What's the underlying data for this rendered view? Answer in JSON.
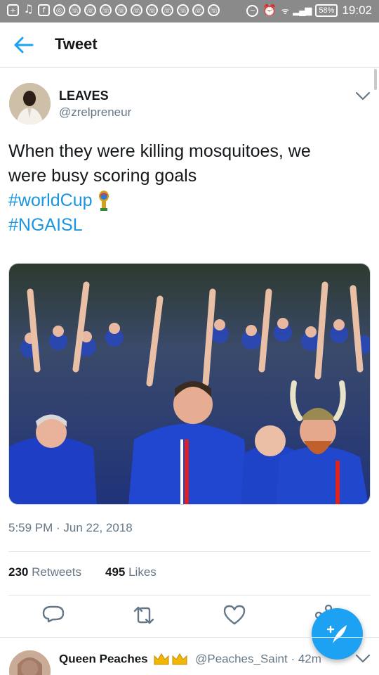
{
  "status_bar": {
    "battery": "58%",
    "time": "19:02",
    "left_icons": [
      "plus-box-icon",
      "music-note-icon",
      "facebook-icon",
      "chrome-icon",
      "whatsapp-icon",
      "whatsapp-icon",
      "whatsapp-icon",
      "whatsapp-icon",
      "whatsapp-icon",
      "whatsapp-icon",
      "whatsapp-icon",
      "whatsapp-icon",
      "whatsapp-icon",
      "whatsapp-icon"
    ],
    "right_icons": [
      "do-not-disturb-icon",
      "alarm-icon",
      "wifi-icon",
      "signal-icon"
    ]
  },
  "header": {
    "title": "Tweet",
    "back_icon": "arrow-left-icon"
  },
  "tweet": {
    "author_name": "LEAVES",
    "author_handle": "@zrelpreneur",
    "text_line_1": "When they were killing mosquitoes, we",
    "text_line_2": "were busy scoring goals",
    "hashtag_1": "#worldCup",
    "hashtag_2": "#NGAISL",
    "emoji": "world-cup-trophy-emoji",
    "timestamp": "5:59 PM · Jun 22, 2018",
    "retweets_count": "230",
    "retweets_label": "Retweets",
    "likes_count": "495",
    "likes_label": "Likes",
    "image_description_icon": "photo-icon"
  },
  "actions": {
    "reply_icon": "reply-icon",
    "retweet_icon": "retweet-icon",
    "like_icon": "heart-icon",
    "share_icon": "share-icon"
  },
  "fab": {
    "icon": "compose-feather-icon"
  },
  "reply_preview": {
    "name": "Queen Peaches",
    "badges": "crown-emoji crown-emoji",
    "handle": "@Peaches_Saint",
    "time": "· 42m"
  },
  "colors": {
    "accent": "#1da1f2",
    "hashtag": "#1b95e0",
    "muted": "#657786",
    "status_bar": "#8a8a8a"
  }
}
